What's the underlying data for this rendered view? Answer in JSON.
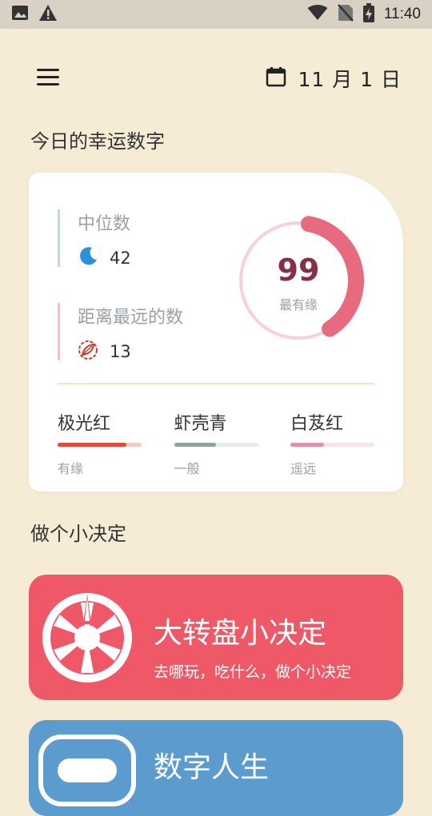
{
  "status_bar": {
    "time": "11:40",
    "icons": [
      "image-icon",
      "alert-icon",
      "wifi-icon",
      "no-sim-icon",
      "battery-charging-icon"
    ]
  },
  "header": {
    "menu_icon": "menu-icon",
    "calendar_icon": "calendar-icon",
    "date": "11 月 1 日"
  },
  "lucky_section": {
    "title": "今日的幸运数字",
    "median": {
      "label": "中位数",
      "value": "42",
      "icon": "moon-icon"
    },
    "farthest": {
      "label": "距离最远的数",
      "value": "13",
      "icon": "leaf-icon"
    },
    "best": {
      "value": "99",
      "caption": "最有缘",
      "progress": 0.38
    },
    "colors": [
      {
        "name": "极光红",
        "level": "有缘",
        "fill": 0.82,
        "color": "#e8483b",
        "track": "#f7c8c4"
      },
      {
        "name": "虾壳青",
        "level": "一般",
        "fill": 0.5,
        "color": "#8fa0a0",
        "track": "#e6ecec"
      },
      {
        "name": "白芨红",
        "level": "遥远",
        "fill": 0.4,
        "color": "#e58fab",
        "track": "#f9e3ea"
      }
    ]
  },
  "decision_section": {
    "title": "做个小决定",
    "wheel": {
      "title": "大转盘小决定",
      "subtitle": "去哪玩，吃什么，做个小决定",
      "icon": "wheel-icon"
    },
    "number_life": {
      "title": "数字人生",
      "icon": "number-card-icon"
    }
  },
  "colors": {
    "background": "#f6ecd6",
    "wheel_card": "#ef5866",
    "number_card": "#5b9bcd",
    "accent_number": "#8a2e46"
  }
}
